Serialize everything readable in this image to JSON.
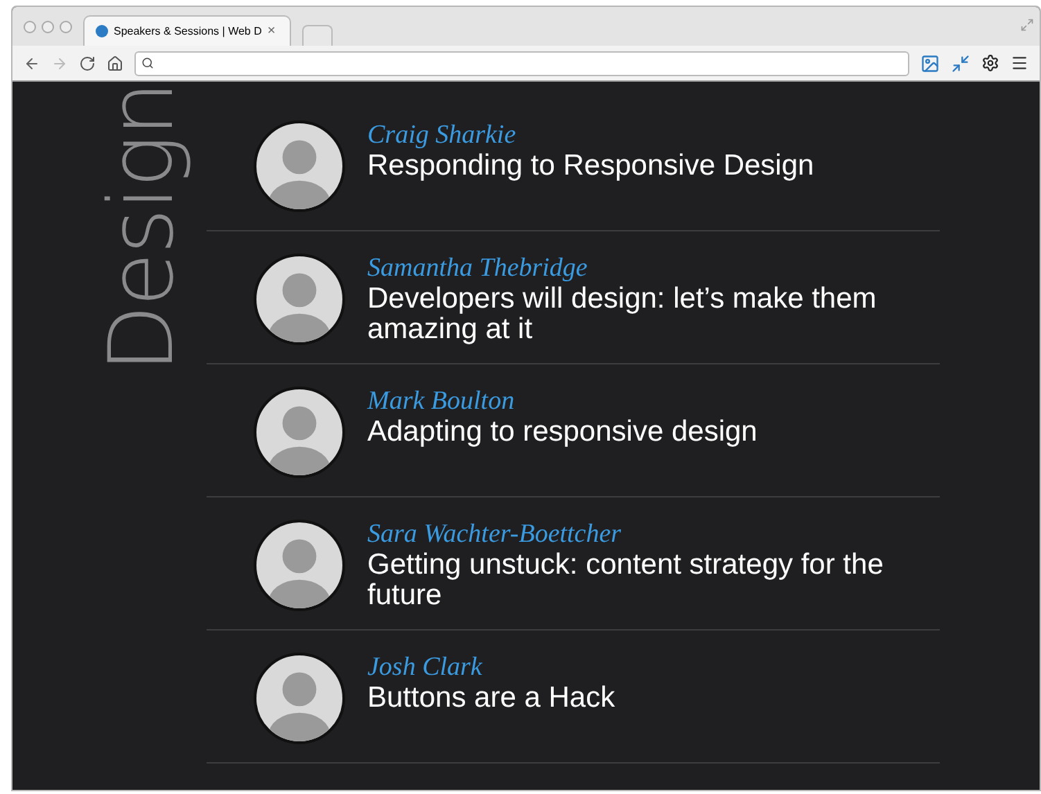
{
  "browser": {
    "tab_title": "Speakers & Sessions | Web D",
    "tab_close": "×"
  },
  "track": {
    "title": "Design"
  },
  "sessions": [
    {
      "speaker": "Craig Sharkie",
      "title": "Responding to Responsive Design"
    },
    {
      "speaker": "Samantha Thebridge",
      "title": "Developers will design: let’s make them amazing at it"
    },
    {
      "speaker": "Mark Boulton",
      "title": "Adapting to responsive design"
    },
    {
      "speaker": "Sara Wachter-Boettcher",
      "title": "Getting unstuck: content strategy for the future"
    },
    {
      "speaker": "Josh Clark",
      "title": "Buttons are a Hack"
    }
  ]
}
